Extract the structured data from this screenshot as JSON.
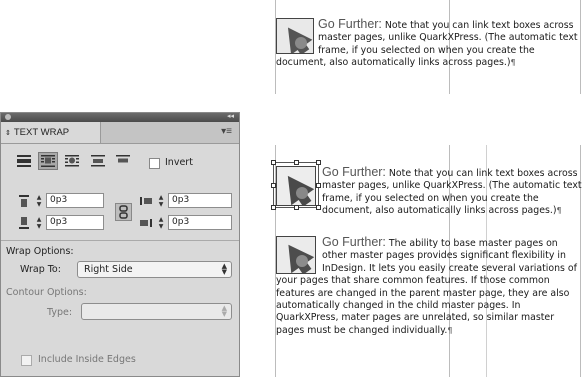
{
  "document": {
    "frame_top": {
      "lead": "Go Further:",
      "body": " Note that you can link text boxes across master pages, unlike QuarkXPress. (The automatic text frame, if you selected on when you create the document, also automatically links across pages.)",
      "pilcrow": "¶"
    },
    "frame_middle": {
      "lead": "Go Further:",
      "body": " Note that you can link text boxes across master pages, unlike QuarkXPress. (The automatic text frame, if you selected on when you create the document, also automatically links across pages.)",
      "pilcrow": "¶"
    },
    "frame_bottom": {
      "lead": "Go Further:",
      "body": " The ability to base master pages on other master pages provides significant flexibility in InDesign. It lets you easily create several variations of your pages that share common features. If those common features are changed in the parent master page, they are also automatically changed in the child master pages. In QuarkXPress, mater pages are unrelated, so similar master pages must be changed individually.",
      "pilcrow": "¶"
    }
  },
  "panel": {
    "title": "TEXT WRAP",
    "invert_label": "Invert",
    "invert_checked": false,
    "offsets": {
      "top": "0p3",
      "bottom": "0p3",
      "left": "0p3",
      "right": "0p3"
    },
    "wrap_options_label": "Wrap Options:",
    "wrap_to_label": "Wrap To:",
    "wrap_to_value": "Right Side",
    "contour_options_label": "Contour Options:",
    "type_label": "Type:",
    "type_value": "",
    "include_inside_edges_label": "Include Inside Edges",
    "include_inside_edges_checked": false,
    "selected_wrap_mode": "wrap-around-bounding-box"
  }
}
